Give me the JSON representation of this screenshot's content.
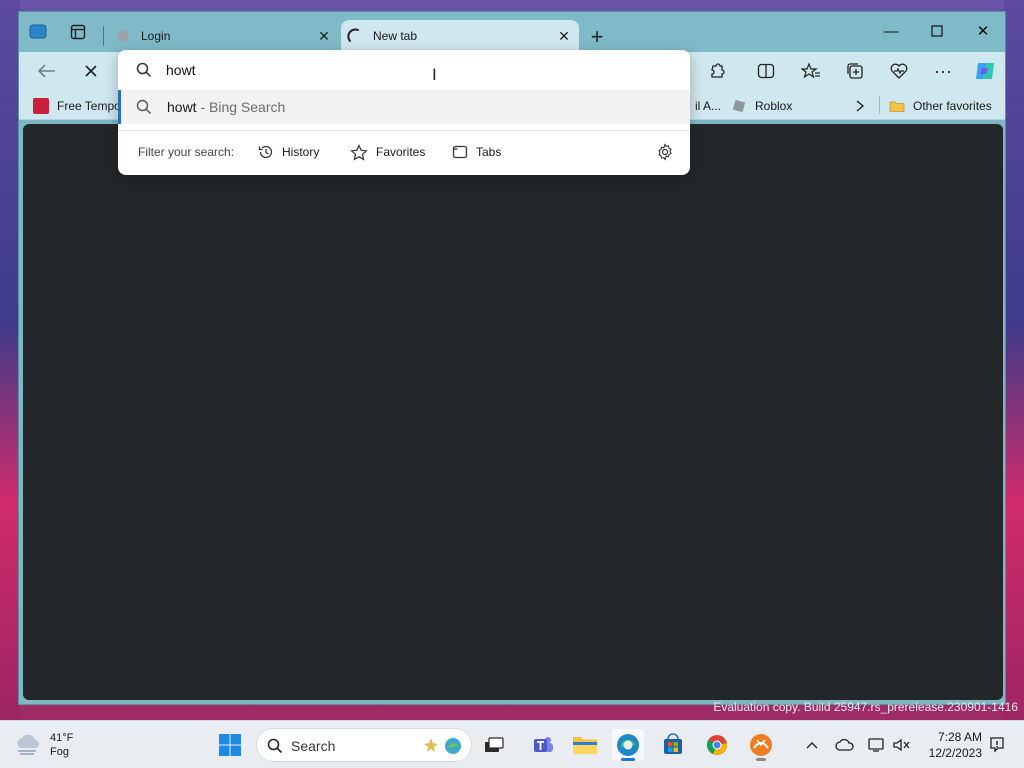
{
  "browser": {
    "tabs": [
      {
        "label": "Login",
        "active": false
      },
      {
        "label": "New tab",
        "active": true
      }
    ],
    "favorites": {
      "items": [
        {
          "label": "Free Tempo"
        },
        {
          "label": "il A..."
        },
        {
          "label": "Roblox"
        }
      ],
      "other_favorites": "Other favorites"
    },
    "omnibox": {
      "query": "howt",
      "suggestion": {
        "main": "howt",
        "sub": " - Bing Search"
      },
      "filter_label": "Filter your search:",
      "filters": [
        "History",
        "Favorites",
        "Tabs"
      ]
    }
  },
  "watermark": "Evaluation copy. Build 25947.rs_prerelease.230901-1416",
  "taskbar": {
    "weather": {
      "temp": "41°F",
      "condition": "Fog"
    },
    "search_label": "Search",
    "clock": {
      "time": "7:28 AM",
      "date": "12/2/2023"
    }
  },
  "colors": {
    "accent": "#2a6fb5",
    "browser_frame": "#7fbac8",
    "toolbar": "#cfe7ee",
    "content_bg": "#24272a"
  }
}
